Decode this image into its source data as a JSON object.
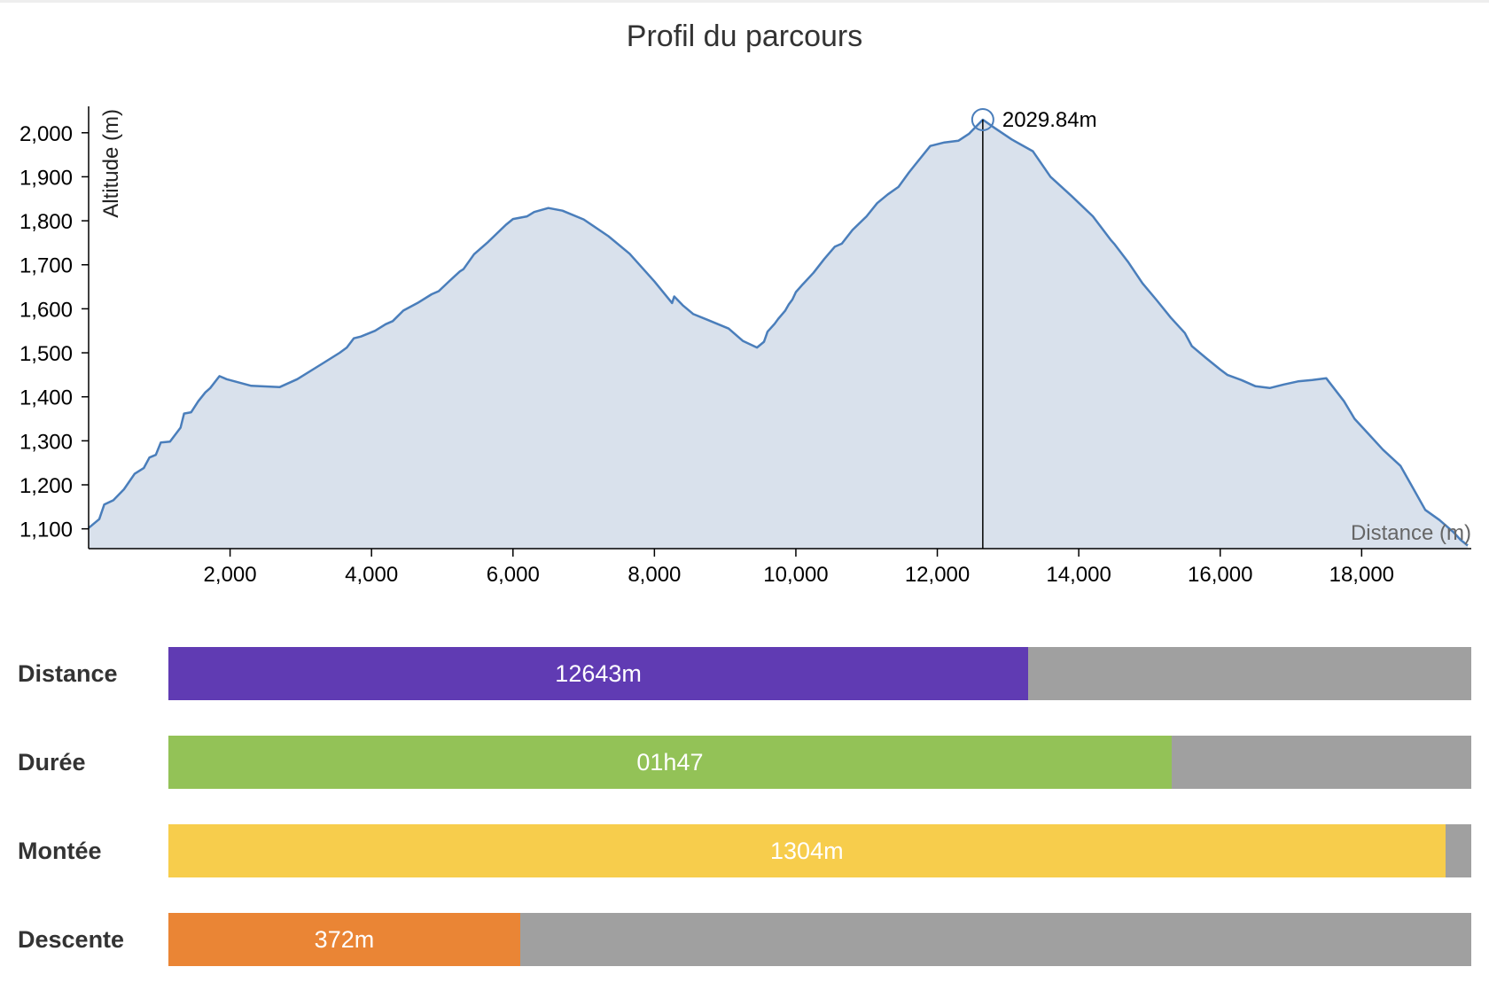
{
  "chart_data": {
    "type": "area",
    "title": "Profil du parcours",
    "xlabel": "Distance (m)",
    "ylabel": "Altitude (m)",
    "xlim": [
      0,
      19550
    ],
    "ylim": [
      1055,
      2060
    ],
    "x_ticks": [
      2000,
      4000,
      6000,
      8000,
      10000,
      12000,
      14000,
      16000,
      18000
    ],
    "x_tick_labels": [
      "2,000",
      "4,000",
      "6,000",
      "8,000",
      "10,000",
      "12,000",
      "14,000",
      "16,000",
      "18,000"
    ],
    "y_ticks": [
      1100,
      1200,
      1300,
      1400,
      1500,
      1600,
      1700,
      1800,
      1900,
      2000
    ],
    "y_tick_labels": [
      "1,100",
      "1,200",
      "1,300",
      "1,400",
      "1,500",
      "1,600",
      "1,700",
      "1,800",
      "1,900",
      "2,000"
    ],
    "series": [
      {
        "color": "#4a7ebb",
        "fill": "#d9e1ec",
        "points": [
          [
            0,
            1102
          ],
          [
            150,
            1122
          ],
          [
            220,
            1155
          ],
          [
            350,
            1165
          ],
          [
            500,
            1190
          ],
          [
            650,
            1225
          ],
          [
            780,
            1238
          ],
          [
            860,
            1262
          ],
          [
            950,
            1268
          ],
          [
            1020,
            1296
          ],
          [
            1150,
            1298
          ],
          [
            1300,
            1330
          ],
          [
            1350,
            1362
          ],
          [
            1450,
            1365
          ],
          [
            1550,
            1390
          ],
          [
            1650,
            1410
          ],
          [
            1720,
            1420
          ],
          [
            1850,
            1447
          ],
          [
            1950,
            1440
          ],
          [
            2300,
            1425
          ],
          [
            2700,
            1422
          ],
          [
            2950,
            1440
          ],
          [
            3300,
            1475
          ],
          [
            3550,
            1500
          ],
          [
            3650,
            1512
          ],
          [
            3750,
            1533
          ],
          [
            3850,
            1537
          ],
          [
            4050,
            1550
          ],
          [
            4200,
            1565
          ],
          [
            4300,
            1572
          ],
          [
            4450,
            1596
          ],
          [
            4650,
            1613
          ],
          [
            4850,
            1633
          ],
          [
            4950,
            1640
          ],
          [
            5100,
            1663
          ],
          [
            5250,
            1685
          ],
          [
            5300,
            1690
          ],
          [
            5450,
            1724
          ],
          [
            5650,
            1752
          ],
          [
            5900,
            1791
          ],
          [
            6000,
            1804
          ],
          [
            6200,
            1810
          ],
          [
            6300,
            1820
          ],
          [
            6500,
            1829
          ],
          [
            6700,
            1823
          ],
          [
            7000,
            1803
          ],
          [
            7350,
            1765
          ],
          [
            7650,
            1725
          ],
          [
            8000,
            1662
          ],
          [
            8250,
            1613
          ],
          [
            8280,
            1628
          ],
          [
            8400,
            1608
          ],
          [
            8550,
            1588
          ],
          [
            8750,
            1575
          ],
          [
            9050,
            1555
          ],
          [
            9250,
            1527
          ],
          [
            9450,
            1512
          ],
          [
            9550,
            1525
          ],
          [
            9600,
            1548
          ],
          [
            9700,
            1566
          ],
          [
            9750,
            1577
          ],
          [
            9850,
            1596
          ],
          [
            9900,
            1610
          ],
          [
            9950,
            1621
          ],
          [
            10000,
            1638
          ],
          [
            10100,
            1656
          ],
          [
            10250,
            1682
          ],
          [
            10400,
            1713
          ],
          [
            10550,
            1741
          ],
          [
            10650,
            1748
          ],
          [
            10800,
            1779
          ],
          [
            11000,
            1810
          ],
          [
            11150,
            1840
          ],
          [
            11300,
            1860
          ],
          [
            11450,
            1877
          ],
          [
            11600,
            1910
          ],
          [
            11700,
            1930
          ],
          [
            11900,
            1970
          ],
          [
            12100,
            1978
          ],
          [
            12300,
            1982
          ],
          [
            12450,
            1998
          ],
          [
            12643,
            2029.84
          ],
          [
            12800,
            2012
          ],
          [
            13050,
            1985
          ],
          [
            13350,
            1958
          ],
          [
            13600,
            1900
          ],
          [
            13900,
            1856
          ],
          [
            14200,
            1810
          ],
          [
            14450,
            1757
          ],
          [
            14500,
            1748
          ],
          [
            14700,
            1706
          ],
          [
            14900,
            1658
          ],
          [
            15100,
            1620
          ],
          [
            15300,
            1580
          ],
          [
            15500,
            1545
          ],
          [
            15600,
            1515
          ],
          [
            15800,
            1488
          ],
          [
            16000,
            1462
          ],
          [
            16100,
            1450
          ],
          [
            16300,
            1438
          ],
          [
            16500,
            1424
          ],
          [
            16700,
            1420
          ],
          [
            16900,
            1428
          ],
          [
            17100,
            1435
          ],
          [
            17300,
            1438
          ],
          [
            17500,
            1442
          ],
          [
            17750,
            1390
          ],
          [
            17900,
            1350
          ],
          [
            18100,
            1315
          ],
          [
            18300,
            1280
          ],
          [
            18550,
            1243
          ],
          [
            18700,
            1200
          ],
          [
            18900,
            1143
          ],
          [
            19100,
            1120
          ],
          [
            19300,
            1092
          ],
          [
            19400,
            1075
          ],
          [
            19500,
            1062
          ]
        ]
      }
    ],
    "marker": {
      "x": 12643,
      "y": 2029.84,
      "label": "2029.84m"
    }
  },
  "stats": [
    {
      "label": "Distance",
      "value": "12643m",
      "fraction": 0.66,
      "color": "#603bb3"
    },
    {
      "label": "Durée",
      "value": "01h47",
      "fraction": 0.77,
      "color": "#93c257"
    },
    {
      "label": "Montée",
      "value": "1304m",
      "fraction": 0.98,
      "color": "#f7cd4c"
    },
    {
      "label": "Descente",
      "value": "372m",
      "fraction": 0.27,
      "color": "#ea8535"
    }
  ]
}
